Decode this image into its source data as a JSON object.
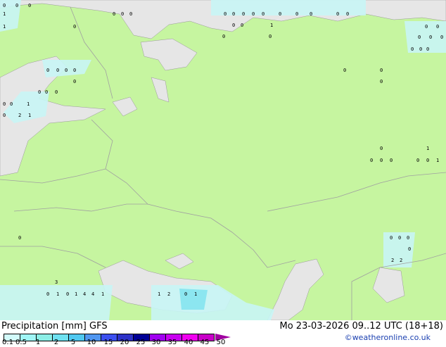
{
  "legend": {
    "title": "Precipitation [mm]  GFS",
    "ticks": [
      "0.1",
      "0.5",
      "1",
      "2",
      "5",
      "10",
      "15",
      "20",
      "25",
      "30",
      "35",
      "40",
      "45",
      "50"
    ],
    "colors": [
      "#d2fafa",
      "#a0f5f5",
      "#8ceee6",
      "#6ee1f0",
      "#50c8f0",
      "#5096f0",
      "#3c50f0",
      "#2d32c8",
      "#000096",
      "#a000f0",
      "#c800f0",
      "#f000f0",
      "#c800c8"
    ]
  },
  "valid_time": "Mo 23-03-2026 09..12 UTC (18+18)",
  "credit": "©weatheronline.co.uk",
  "map_colors": {
    "land": "#c6f5a0",
    "sea": "#e6e6e6",
    "precip": "#c8f5f5",
    "precip2": "#8ce6f0",
    "border": "#a0a0a0"
  },
  "markers": [
    "0",
    "0",
    "0",
    "0",
    "0",
    "0",
    "0",
    "0",
    "0",
    "0",
    "0",
    "0",
    "0",
    "0",
    "0",
    "0",
    "1",
    "0",
    "0",
    "0",
    "0",
    "0",
    "0",
    "0",
    "0",
    "1",
    "0",
    "0",
    "0",
    "1",
    "0",
    "0",
    "0",
    "0",
    "0",
    "0",
    "0",
    "0",
    "0",
    "0",
    "0",
    "0",
    "1",
    "0",
    "2",
    "1",
    "0",
    "0",
    "0",
    "0",
    "0",
    "0",
    "0",
    "1",
    "0",
    "0",
    "1",
    "0",
    "0",
    "0",
    "0",
    "0",
    "2",
    "2",
    "3",
    "0",
    "1",
    "0",
    "1",
    "4",
    "4",
    "1",
    "1",
    "2",
    "0",
    "1"
  ]
}
